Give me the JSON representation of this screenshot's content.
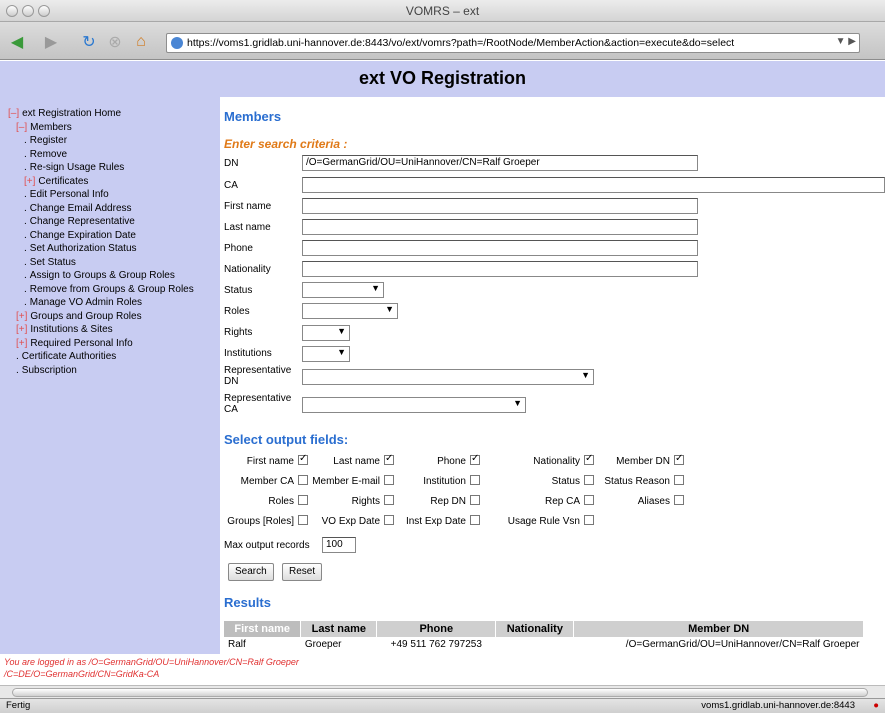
{
  "window": {
    "title": "VOMRS – ext"
  },
  "browser": {
    "url": "https://voms1.gridlab.uni-hannover.de:8443/vo/ext/vomrs?path=/RootNode/MemberAction&action=execute&do=select",
    "status_left": "Fertig",
    "status_right": "voms1.gridlab.uni-hannover.de:8443"
  },
  "page": {
    "heading": "ext VO Registration"
  },
  "sidebar": {
    "items": [
      {
        "prefix": "[–]",
        "label": "ext Registration Home",
        "indent": 0
      },
      {
        "prefix": "[–]",
        "label": "Members",
        "indent": 1
      },
      {
        "prefix": ".",
        "label": "Register",
        "indent": 2
      },
      {
        "prefix": ".",
        "label": "Remove",
        "indent": 2
      },
      {
        "prefix": ".",
        "label": "Re-sign Usage Rules",
        "indent": 2
      },
      {
        "prefix": "[+]",
        "label": "Certificates",
        "indent": 2
      },
      {
        "prefix": ".",
        "label": "Edit Personal Info",
        "indent": 2
      },
      {
        "prefix": ".",
        "label": "Change Email Address",
        "indent": 2
      },
      {
        "prefix": ".",
        "label": "Change Representative",
        "indent": 2
      },
      {
        "prefix": ".",
        "label": "Change Expiration Date",
        "indent": 2
      },
      {
        "prefix": ".",
        "label": "Set Authorization Status",
        "indent": 2
      },
      {
        "prefix": ".",
        "label": "Set Status",
        "indent": 2
      },
      {
        "prefix": ".",
        "label": "Assign to Groups & Group Roles",
        "indent": 2
      },
      {
        "prefix": ".",
        "label": "Remove from Groups & Group Roles",
        "indent": 2
      },
      {
        "prefix": ".",
        "label": "Manage VO Admin Roles",
        "indent": 2
      },
      {
        "prefix": "[+]",
        "label": "Groups and Group Roles",
        "indent": 1
      },
      {
        "prefix": "[+]",
        "label": "Institutions & Sites",
        "indent": 1
      },
      {
        "prefix": "[+]",
        "label": "Required Personal Info",
        "indent": 1
      },
      {
        "prefix": ".",
        "label": "Certificate Authorities",
        "indent": 1
      },
      {
        "prefix": ".",
        "label": "Subscription",
        "indent": 1
      }
    ]
  },
  "main": {
    "section_title": "Members",
    "search_title": "Enter search criteria :",
    "fields": {
      "dn_label": "DN",
      "dn_value": "/O=GermanGrid/OU=UniHannover/CN=Ralf Groeper",
      "ca_label": "CA",
      "first_name_label": "First name",
      "last_name_label": "Last name",
      "phone_label": "Phone",
      "nationality_label": "Nationality",
      "status_label": "Status",
      "roles_label": "Roles",
      "rights_label": "Rights",
      "institutions_label": "Institutions",
      "rep_dn_label_1": "Representative",
      "rep_dn_label_2": "DN",
      "rep_ca_label_1": "Representative",
      "rep_ca_label_2": "CA"
    },
    "output_title": "Select output fields:",
    "output_fields": [
      [
        "First name",
        true
      ],
      [
        "Last name",
        true
      ],
      [
        "Phone",
        true
      ],
      [
        "Nationality",
        true
      ],
      [
        "Member DN",
        true
      ],
      [
        "Member CA",
        false
      ],
      [
        "Member E-mail",
        false
      ],
      [
        "Institution",
        false
      ],
      [
        "Status",
        false
      ],
      [
        "Status Reason",
        false
      ],
      [
        "Roles",
        false
      ],
      [
        "Rights",
        false
      ],
      [
        "Rep DN",
        false
      ],
      [
        "Rep CA",
        false
      ],
      [
        "Aliases",
        false
      ],
      [
        "Groups [Roles]",
        false
      ],
      [
        "VO Exp Date",
        false
      ],
      [
        "Inst Exp Date",
        false
      ],
      [
        "Usage Rule Vsn",
        false
      ]
    ],
    "max_output_label": "Max output records",
    "max_output_value": "100",
    "search_button": "Search",
    "reset_button": "Reset",
    "results_title": "Results",
    "results": {
      "columns": [
        "First name",
        "Last name",
        "Phone",
        "Nationality",
        "Member DN"
      ],
      "rows": [
        [
          "Ralf",
          "Groeper",
          "+49 511 762 797253",
          "",
          "/O=GermanGrid/OU=UniHannover/CN=Ralf Groeper"
        ]
      ]
    }
  },
  "login": {
    "line1": "You are logged in as /O=GermanGrid/OU=UniHannover/CN=Ralf Groeper",
    "line2": "/C=DE/O=GermanGrid/CN=GridKa-CA"
  }
}
